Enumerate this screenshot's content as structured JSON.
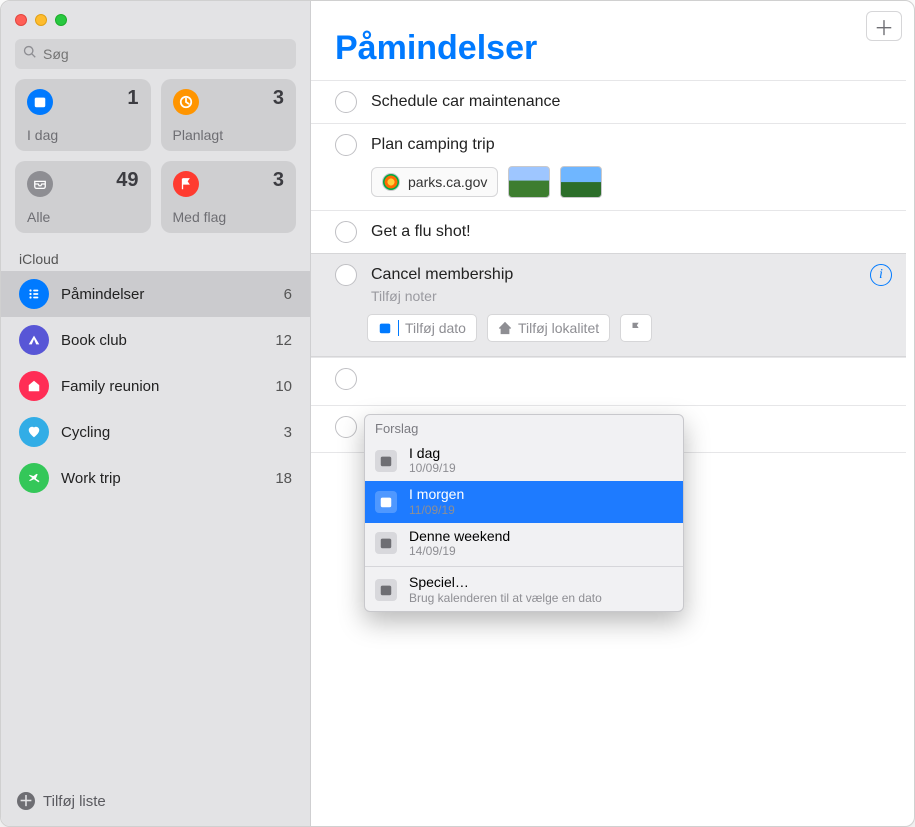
{
  "search": {
    "placeholder": "Søg"
  },
  "cards": [
    {
      "label": "I dag",
      "count": "1",
      "iconClass": "ic-blue",
      "icon": "calendar"
    },
    {
      "label": "Planlagt",
      "count": "3",
      "iconClass": "ic-orange",
      "icon": "clock"
    },
    {
      "label": "Alle",
      "count": "49",
      "iconClass": "ic-gray",
      "icon": "tray"
    },
    {
      "label": "Med flag",
      "count": "3",
      "iconClass": "ic-red",
      "icon": "flag"
    }
  ],
  "section": {
    "header": "iCloud"
  },
  "lists": [
    {
      "name": "Påmindelser",
      "count": "6",
      "color": "c-blue",
      "selected": true,
      "glyph": "list"
    },
    {
      "name": "Book club",
      "count": "12",
      "color": "c-purple",
      "selected": false,
      "glyph": "tent"
    },
    {
      "name": "Family reunion",
      "count": "10",
      "color": "c-pink",
      "selected": false,
      "glyph": "home"
    },
    {
      "name": "Cycling",
      "count": "3",
      "color": "c-teal",
      "selected": false,
      "glyph": "heart"
    },
    {
      "name": "Work trip",
      "count": "18",
      "color": "c-green",
      "selected": false,
      "glyph": "plane"
    }
  ],
  "sidebar_footer": {
    "label": "Tilføj liste"
  },
  "main": {
    "title": "Påmindelser"
  },
  "reminders": [
    {
      "title": "Schedule car maintenance"
    },
    {
      "title": "Plan camping trip",
      "link": "parks.ca.gov",
      "has_thumbs": true
    },
    {
      "title": "Get a flu shot!"
    },
    {
      "title": "Cancel membership",
      "editing": true,
      "notes_placeholder": "Tilføj noter",
      "date_chip": "Tilføj dato",
      "loc_chip": "Tilføj lokalitet"
    }
  ],
  "suggestions": {
    "header": "Forslag",
    "options": [
      {
        "main": "I dag",
        "sub": "10/09/19",
        "selected": false
      },
      {
        "main": "I morgen",
        "sub": "11/09/19",
        "selected": true
      },
      {
        "main": "Denne weekend",
        "sub": "14/09/19",
        "selected": false
      }
    ],
    "custom": {
      "main": "Speciel…",
      "sub": "Brug kalenderen til at vælge en dato"
    }
  }
}
